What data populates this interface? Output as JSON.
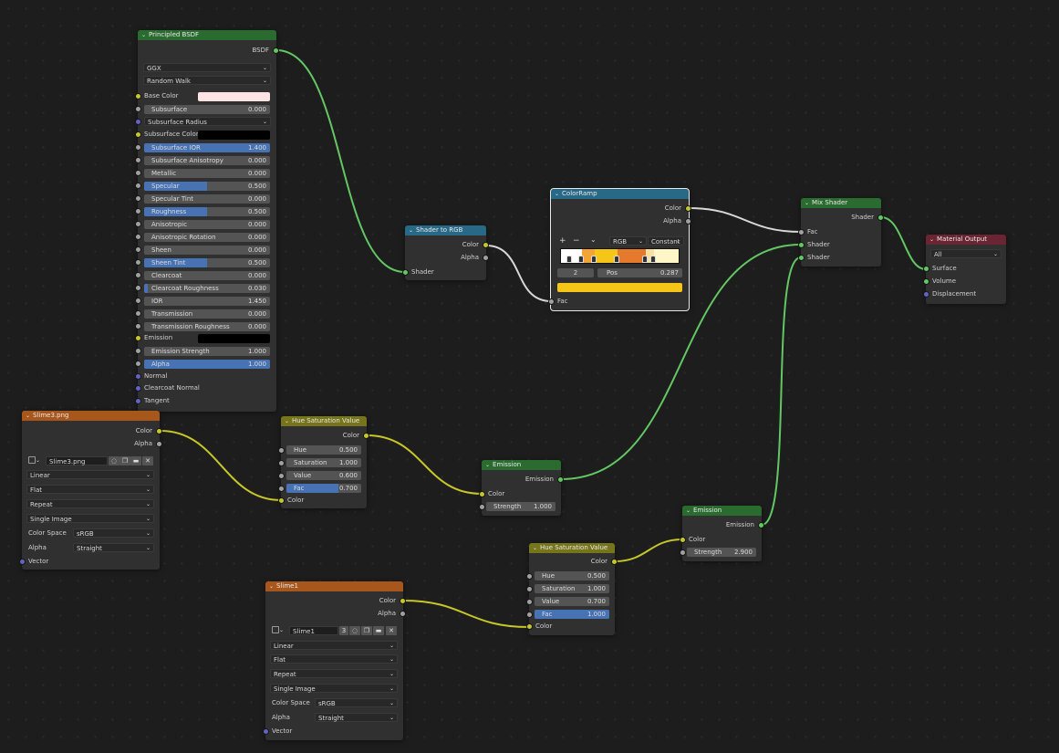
{
  "colors": {
    "bg": "#1d1d1d",
    "shader_wire": "#63c763",
    "color_wire": "#c7c729",
    "float_wire": "#a1a1a1",
    "slider": "#4772b3"
  },
  "bsdf": {
    "title": "Principled BSDF",
    "output": "BSDF",
    "distribution": "GGX",
    "subsurface_method": "Random Walk",
    "base_color_label": "Base Color",
    "subsurface": {
      "label": "Subsurface",
      "value": "0.000"
    },
    "subsurface_radius": "Subsurface Radius",
    "subsurface_color_label": "Subsurface Color",
    "sliders": [
      {
        "label": "Subsurface IOR",
        "value": "1.400",
        "fill": 1.0
      },
      {
        "label": "Subsurface Anisotropy",
        "value": "0.000",
        "fill": 0
      },
      {
        "label": "Metallic",
        "value": "0.000",
        "fill": 0
      },
      {
        "label": "Specular",
        "value": "0.500",
        "fill": 0.5
      },
      {
        "label": "Specular Tint",
        "value": "0.000",
        "fill": 0
      },
      {
        "label": "Roughness",
        "value": "0.500",
        "fill": 0.5
      },
      {
        "label": "Anisotropic",
        "value": "0.000",
        "fill": 0
      },
      {
        "label": "Anisotropic Rotation",
        "value": "0.000",
        "fill": 0
      },
      {
        "label": "Sheen",
        "value": "0.000",
        "fill": 0
      },
      {
        "label": "Sheen Tint",
        "value": "0.500",
        "fill": 0.5
      },
      {
        "label": "Clearcoat",
        "value": "0.000",
        "fill": 0
      },
      {
        "label": "Clearcoat Roughness",
        "value": "0.030",
        "fill": 0.03
      },
      {
        "label": "IOR",
        "value": "1.450",
        "fill": 0
      },
      {
        "label": "Transmission",
        "value": "0.000",
        "fill": 0
      },
      {
        "label": "Transmission Roughness",
        "value": "0.000",
        "fill": 0
      }
    ],
    "emission_label": "Emission",
    "emission_strength": {
      "label": "Emission Strength",
      "value": "1.000"
    },
    "alpha": {
      "label": "Alpha",
      "value": "1.000"
    },
    "normal": "Normal",
    "clearcoat_normal": "Clearcoat Normal",
    "tangent": "Tangent"
  },
  "shader_to_rgb": {
    "title": "Shader to RGB",
    "out_color": "Color",
    "out_alpha": "Alpha",
    "in_shader": "Shader"
  },
  "colorramp": {
    "title": "ColorRamp",
    "out_color": "Color",
    "out_alpha": "Alpha",
    "plus": "+",
    "minus": "−",
    "chevron": "⌄",
    "mode": "RGB",
    "interp": "Constant",
    "index": "2",
    "pos_label": "Pos",
    "pos_value": "0.287",
    "in_fac": "Fac",
    "stops": [
      {
        "pos": 0.08,
        "color": "#ffffff"
      },
      {
        "pos": 0.18,
        "color": "#f2a437"
      },
      {
        "pos": 0.287,
        "color": "#f5c518"
      },
      {
        "pos": 0.48,
        "color": "#e5792c"
      },
      {
        "pos": 0.72,
        "color": "#f8e0a0"
      },
      {
        "pos": 0.79,
        "color": "#fff6c8"
      }
    ]
  },
  "mix_shader": {
    "title": "Mix Shader",
    "out_shader": "Shader",
    "in_fac": "Fac",
    "in_shader1": "Shader",
    "in_shader2": "Shader"
  },
  "material_output": {
    "title": "Material Output",
    "target": "All",
    "in_surface": "Surface",
    "in_volume": "Volume",
    "in_displacement": "Displacement"
  },
  "image1": {
    "title": "Slime3.png",
    "out_color": "Color",
    "out_alpha": "Alpha",
    "image_name": "Slime3.png",
    "users": "",
    "interpolation": "Linear",
    "projection": "Flat",
    "extension": "Repeat",
    "source": "Single Image",
    "color_space_label": "Color Space",
    "color_space": "sRGB",
    "alpha_label": "Alpha",
    "alpha_mode": "Straight",
    "in_vector": "Vector"
  },
  "image2": {
    "title": "Slime1",
    "out_color": "Color",
    "out_alpha": "Alpha",
    "image_name": "Slime1",
    "users": "3",
    "interpolation": "Linear",
    "projection": "Flat",
    "extension": "Repeat",
    "source": "Single Image",
    "color_space_label": "Color Space",
    "color_space": "sRGB",
    "alpha_label": "Alpha",
    "alpha_mode": "Straight",
    "in_vector": "Vector"
  },
  "hsv1": {
    "title": "Hue Saturation Value",
    "out_color": "Color",
    "hue": {
      "label": "Hue",
      "value": "0.500"
    },
    "saturation": {
      "label": "Saturation",
      "value": "1.000"
    },
    "value": {
      "label": "Value",
      "value": "0.600"
    },
    "fac": {
      "label": "Fac",
      "value": "0.700",
      "fill": 0.7
    },
    "in_color": "Color"
  },
  "hsv2": {
    "title": "Hue Saturation Value",
    "out_color": "Color",
    "hue": {
      "label": "Hue",
      "value": "0.500"
    },
    "saturation": {
      "label": "Saturation",
      "value": "1.000"
    },
    "value": {
      "label": "Value",
      "value": "0.700"
    },
    "fac": {
      "label": "Fac",
      "value": "1.000",
      "fill": 1.0
    },
    "in_color": "Color"
  },
  "emission1": {
    "title": "Emission",
    "out_emission": "Emission",
    "in_color": "Color",
    "strength": {
      "label": "Strength",
      "value": "1.000"
    }
  },
  "emission2": {
    "title": "Emission",
    "out_emission": "Emission",
    "in_color": "Color",
    "strength": {
      "label": "Strength",
      "value": "2.900"
    }
  }
}
